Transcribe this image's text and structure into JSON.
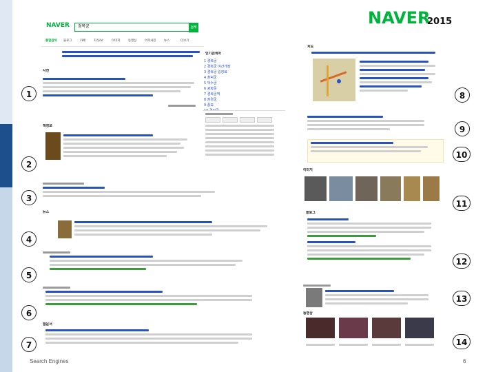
{
  "header": {
    "brand": "NAVER",
    "year": "2015"
  },
  "screenshot": {
    "logo": "NAVER",
    "query": "경복궁",
    "search_button": "검색",
    "tabs": [
      "통합검색",
      "블로그",
      "카페",
      "지식iN",
      "이미지",
      "동영상",
      "어학사전",
      "뉴스",
      "더보기"
    ],
    "sections": {
      "dictionary": "사전",
      "book": "책정보",
      "realtime": "인기검색어",
      "news": "뉴스",
      "map": "지도",
      "images": "이미지",
      "web": "웹문서",
      "video": "동영상",
      "blog": "블로그"
    },
    "right_list": [
      "1 경복궁",
      "2 경복궁 야간개장",
      "3 경복궁 입장료",
      "4 창덕궁",
      "5 덕수궁",
      "6 광화문",
      "7 경복궁역",
      "8 창경궁",
      "9 종묘",
      "10 경희궁"
    ]
  },
  "callouts": [
    "1",
    "2",
    "3",
    "4",
    "5",
    "6",
    "7",
    "8",
    "9",
    "10",
    "11",
    "12",
    "13",
    "14"
  ],
  "footer": {
    "title": "Search Engines",
    "page": "6"
  },
  "colors": {
    "accent": "#00b33c",
    "link": "#2a52be",
    "band_dark": "#1d4f8c",
    "band_light": "#c7d7ea"
  }
}
